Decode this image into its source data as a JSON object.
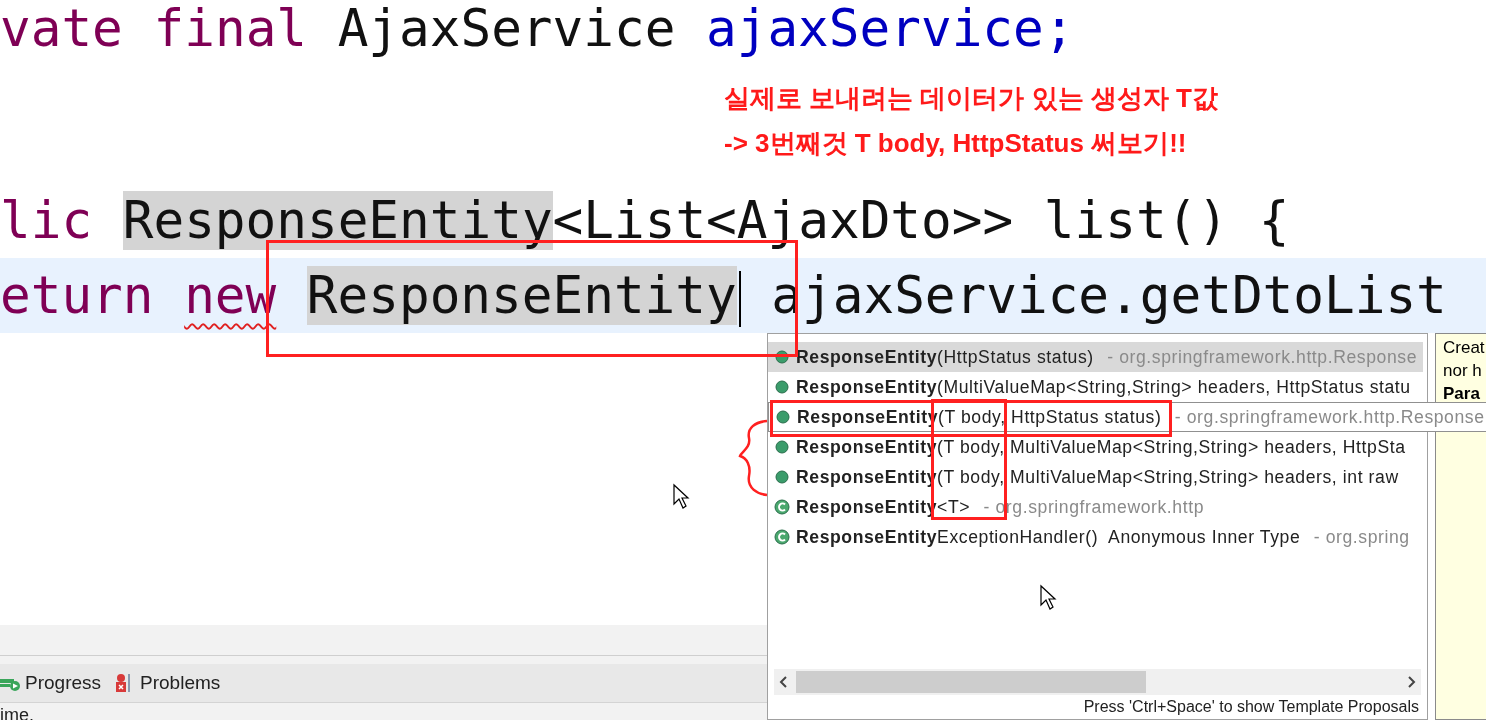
{
  "editor": {
    "lines": [
      {
        "current": false,
        "tokens": [
          {
            "text": "vate final",
            "kind": "keyword",
            "squiggle": false
          },
          {
            "text": "AjaxService",
            "kind": "plain",
            "squiggle": false,
            "joined": false
          },
          {
            "text": "ajaxService;",
            "kind": "field",
            "squiggle": false,
            "joined": false
          }
        ]
      },
      {
        "current": false,
        "tokens": [
          {
            "text": "lic",
            "kind": "keyword",
            "squiggle": false
          },
          {
            "text": "ResponseEntity",
            "kind": "occurrence",
            "squiggle": false,
            "joined": false
          },
          {
            "text": "<List<AjaxDto>> list() {",
            "kind": "plain",
            "squiggle": false,
            "joined": true
          }
        ]
      },
      {
        "current": true,
        "tokens": [
          {
            "text": "eturn",
            "kind": "keyword",
            "squiggle": false
          },
          {
            "text": "new",
            "kind": "keyword",
            "squiggle": true,
            "joined": false
          },
          {
            "text": "ResponseEntity",
            "kind": "occurrence",
            "squiggle": false,
            "joined": false
          },
          {
            "text": "ajaxService.getDtoList",
            "kind": "plain",
            "squiggle": false,
            "joined": false
          }
        ]
      }
    ]
  },
  "note": [
    "실제로 보내려는 데이터가 있는 생성자 T값",
    "-> 3번째것 T body, HttpStatus 써보기!!"
  ],
  "completion": {
    "items": [
      {
        "kind": "method",
        "name": "ResponseEntity",
        "detail": "(HttpStatus status)",
        "qualifier": " - org.springframework.http.Response",
        "selected": true,
        "hovered": false
      },
      {
        "kind": "method",
        "name": "ResponseEntity",
        "detail": "(MultiValueMap<String,String> headers, HttpStatus statu",
        "selected": false,
        "hovered": false
      },
      {
        "kind": "method",
        "name": "ResponseEntity",
        "detail": "(T body, HttpStatus status)",
        "qualifier": " - org.springframework.http.Response",
        "selected": false,
        "hovered": true
      },
      {
        "kind": "method",
        "name": "ResponseEntity",
        "detail": "(T body, MultiValueMap<String,String> headers, HttpSta",
        "selected": false,
        "hovered": false
      },
      {
        "kind": "method",
        "name": "ResponseEntity",
        "detail": "(T body, MultiValueMap<String,String> headers, int raw",
        "selected": false,
        "hovered": false
      },
      {
        "kind": "class",
        "name": "ResponseEntity",
        "detail": "<T>",
        "qualifier": " - org.springframework.http",
        "selected": false,
        "hovered": false
      },
      {
        "kind": "class",
        "name": "ResponseEntity",
        "detail": "ExceptionHandler()  Anonymous Inner Type",
        "qualifier": " - org.spring",
        "selected": false,
        "hovered": false
      }
    ],
    "footer": "Press 'Ctrl+Space' to show Template Proposals",
    "doc": [
      {
        "text": "Creat",
        "bold": false
      },
      {
        "text": "nor h",
        "bold": false
      },
      {
        "text": "Para",
        "bold": true
      }
    ]
  },
  "bottom_panel": {
    "tabs": [
      {
        "label": "Progress",
        "kind": "progress"
      },
      {
        "label": "Problems",
        "kind": "problems"
      }
    ],
    "status": "ime."
  }
}
